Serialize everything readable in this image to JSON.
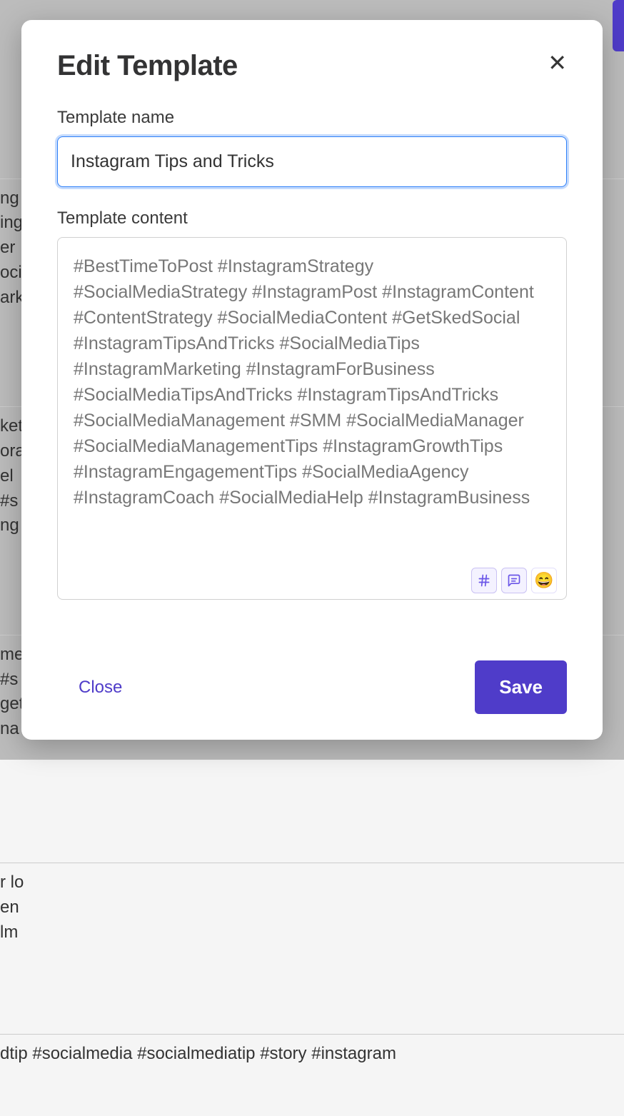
{
  "modal": {
    "title": "Edit Template",
    "close_x": "✕",
    "name_label": "Template name",
    "name_value": "Instagram Tips and Tricks",
    "content_label": "Template content",
    "content_value": "#BestTimeToPost #InstagramStrategy #SocialMediaStrategy #InstagramPost #InstagramContent #ContentStrategy #SocialMediaContent #GetSkedSocial #InstagramTipsAndTricks #SocialMediaTips #InstagramMarketing #InstagramForBusiness #SocialMediaTipsAndTricks #InstagramTipsAndTricks #SocialMediaManagement #SMM #SocialMediaManager #SocialMediaManagementTips #InstagramGrowthTips #InstagramEngagementTips #SocialMediaAgency #InstagramCoach #SocialMediaHelp #InstagramBusiness",
    "toolbar": {
      "hashtag_title": "Insert hashtag",
      "comment_title": "Insert comment",
      "emoji_title": "Insert emoji",
      "emoji_glyph": "😄"
    },
    "footer": {
      "close_label": "Close",
      "save_label": "Save"
    }
  },
  "background": {
    "row1": "ng\ning\ner\noci\nark",
    "row2": "ket\nora\nel\n#s\nng",
    "row3": "me\n#s\nget\nna",
    "row4": "r lo\nen\nlm",
    "bottom": "dtip #socialmedia #socialmediatip #story #instagram"
  }
}
